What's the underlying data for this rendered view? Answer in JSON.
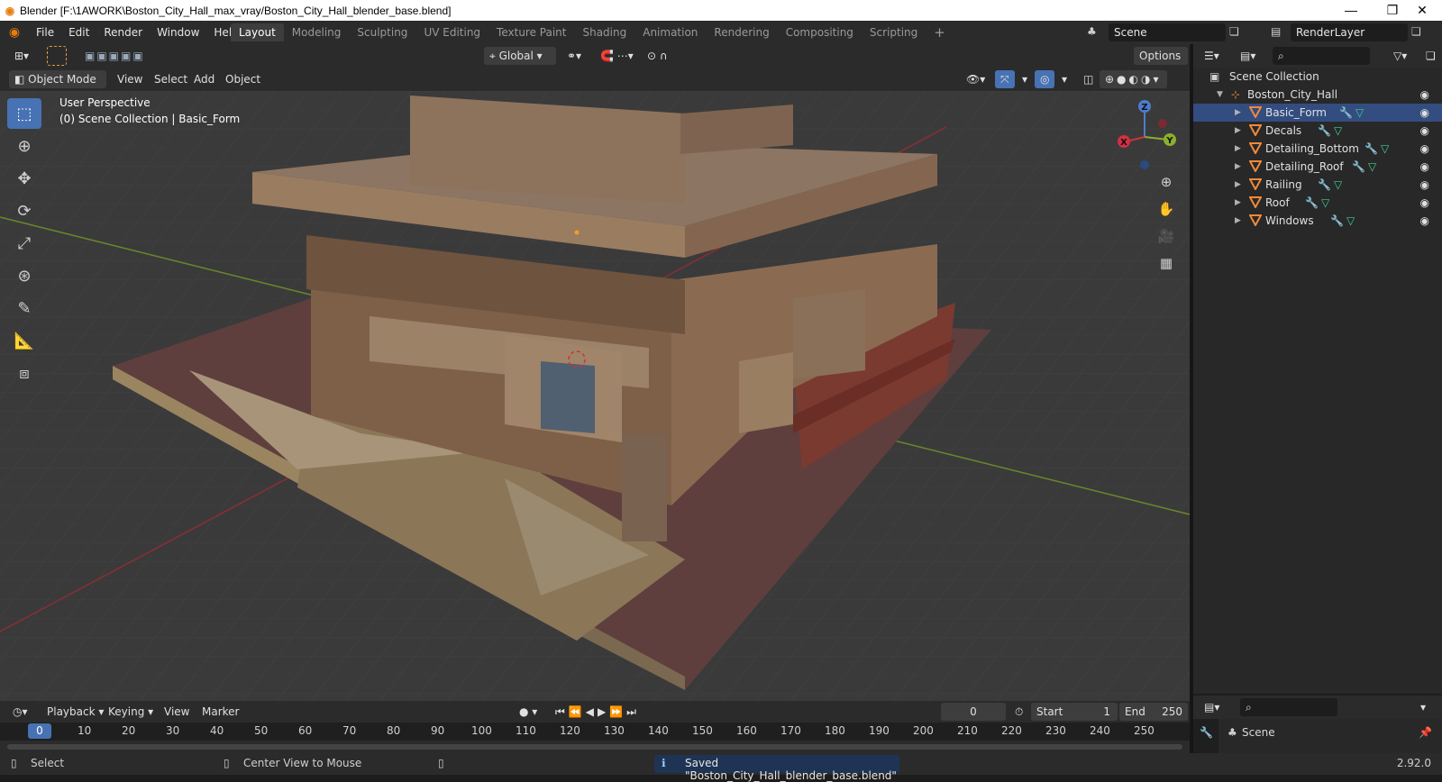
{
  "window": {
    "title": "Blender [F:\\1AWORK\\Boston_City_Hall_max_vray/Boston_City_Hall_blender_base.blend]",
    "minimize": "—",
    "restore": "❐",
    "close": "✕"
  },
  "menu": [
    "File",
    "Edit",
    "Render",
    "Window",
    "Help"
  ],
  "workspaces": [
    "Layout",
    "Modeling",
    "Sculpting",
    "UV Editing",
    "Texture Paint",
    "Shading",
    "Animation",
    "Rendering",
    "Compositing",
    "Scripting"
  ],
  "active_workspace": "Layout",
  "add_workspace": "+",
  "scene": {
    "label": "Scene",
    "render_layer": "RenderLayer"
  },
  "tool_header": {
    "orientation": "Global",
    "options": "Options"
  },
  "viewport_header": {
    "mode": "Object Mode",
    "menus": [
      "View",
      "Select",
      "Add",
      "Object"
    ]
  },
  "viewport": {
    "perspective": "User Perspective",
    "collection_info": "(0) Scene Collection | Basic_Form",
    "axes": {
      "x": "X",
      "y": "Y",
      "z": "Z"
    }
  },
  "outliner": {
    "root": "Scene Collection",
    "collection": "Boston_City_Hall",
    "objects": [
      "Basic_Form",
      "Decals",
      "Detailing_Bottom",
      "Detailing_Roof",
      "Railing",
      "Roof",
      "Windows"
    ],
    "selected": "Basic_Form"
  },
  "properties": {
    "scene_label": "Scene"
  },
  "timeline": {
    "menus": [
      "Playback",
      "Keying",
      "View",
      "Marker"
    ],
    "current_frame": "0",
    "start_label": "Start",
    "start_value": "1",
    "end_label": "End",
    "end_value": "250",
    "ruler": [
      "0",
      "10",
      "20",
      "30",
      "40",
      "50",
      "60",
      "70",
      "80",
      "90",
      "100",
      "110",
      "120",
      "130",
      "140",
      "150",
      "160",
      "170",
      "180",
      "190",
      "200",
      "210",
      "220",
      "230",
      "240",
      "250"
    ]
  },
  "status": {
    "select": "Select",
    "center_view": "Center View to Mouse",
    "message": "Saved \"Boston_City_Hall_blender_base.blend\"",
    "version": "2.92.0"
  }
}
